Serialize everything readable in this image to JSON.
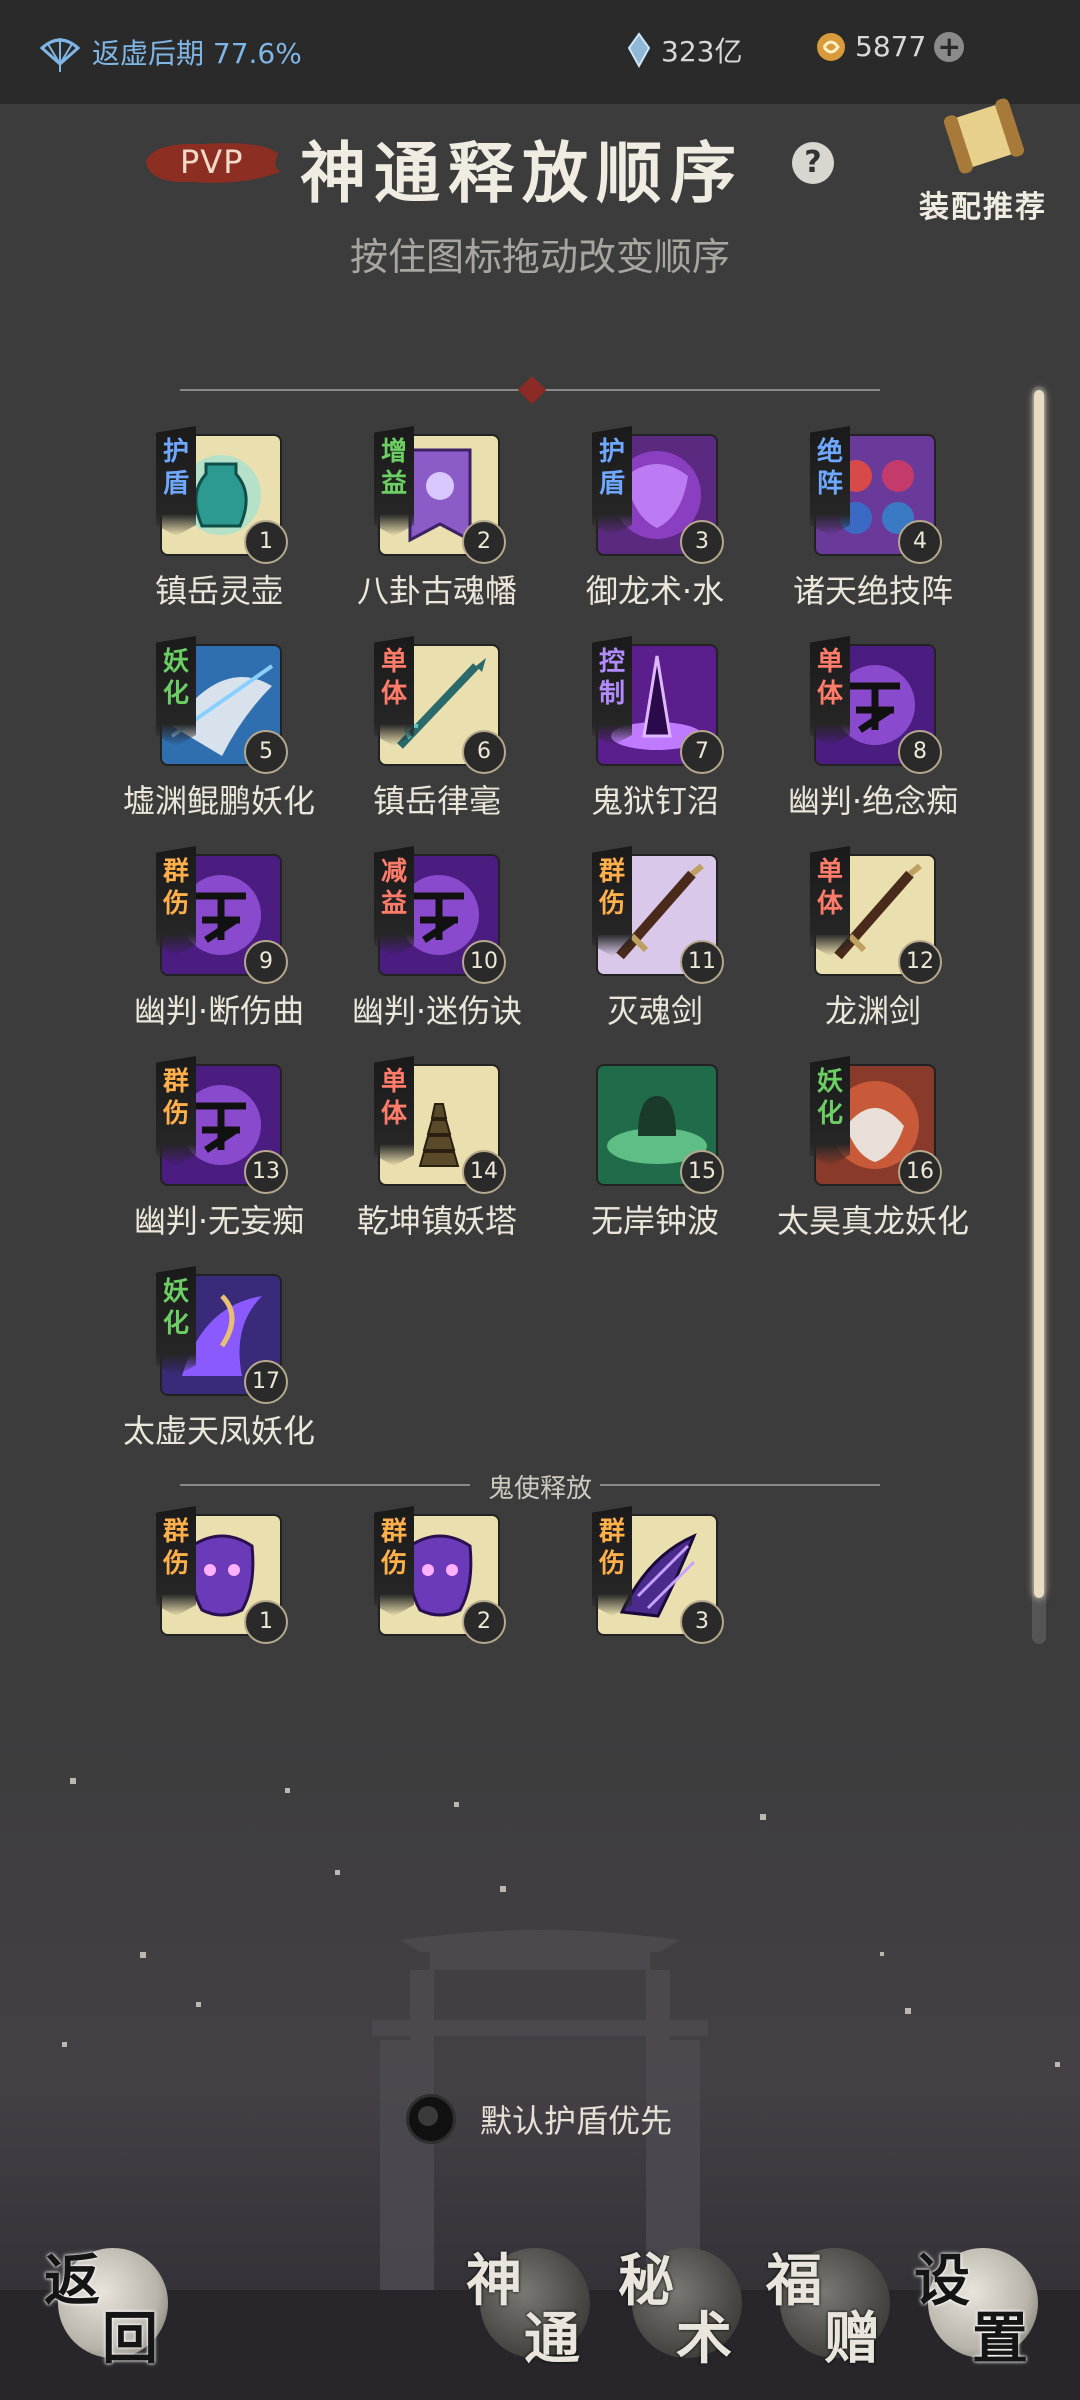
{
  "status": {
    "stage_label": "返虚后期 77.6%",
    "spirit_stones": "323亿",
    "currency": "5877"
  },
  "header": {
    "pvp_badge": "PVP",
    "title": "神通释放顺序",
    "recommend_label": "装配推荐",
    "subtitle": "按住图标拖动改变顺序"
  },
  "skills": [
    {
      "tag": "护盾",
      "tag_color": "#6fa8ff",
      "num": "1",
      "name": "镇岳灵壶",
      "bg": "#eadfae",
      "icon": "vase-icon"
    },
    {
      "tag": "增益",
      "tag_color": "#6ccf63",
      "num": "2",
      "name": "八卦古魂幡",
      "bg": "#eadfae",
      "icon": "banner-icon"
    },
    {
      "tag": "护盾",
      "tag_color": "#6fa8ff",
      "num": "3",
      "name": "御龙术·水",
      "bg": "#5b2a80",
      "icon": "dragon-mask-icon"
    },
    {
      "tag": "绝阵",
      "tag_color": "#6fa8ff",
      "num": "4",
      "name": "诸天绝技阵",
      "bg": "#6a3a9a",
      "icon": "formation-icon"
    },
    {
      "tag": "妖化",
      "tag_color": "#6ccf63",
      "num": "5",
      "name": "墟渊鲲鹏妖化",
      "bg": "#2f6fb0",
      "icon": "kunpeng-icon"
    },
    {
      "tag": "单体",
      "tag_color": "#ff7b6a",
      "num": "6",
      "name": "镇岳律毫",
      "bg": "#eadfae",
      "icon": "spear-icon"
    },
    {
      "tag": "控制",
      "tag_color": "#b28cff",
      "num": "7",
      "name": "鬼狱钉沼",
      "bg": "#5a1f8c",
      "icon": "spike-icon"
    },
    {
      "tag": "单体",
      "tag_color": "#ff7b6a",
      "num": "8",
      "name": "幽判·绝念痴",
      "bg": "#4b1d80",
      "icon": "rune-icon"
    },
    {
      "tag": "群伤",
      "tag_color": "#ffb04a",
      "num": "9",
      "name": "幽判·断伤曲",
      "bg": "#4b1d80",
      "icon": "rune-icon"
    },
    {
      "tag": "减益",
      "tag_color": "#ff7b6a",
      "num": "10",
      "name": "幽判·迷伤诀",
      "bg": "#4b1d80",
      "icon": "rune-icon"
    },
    {
      "tag": "群伤",
      "tag_color": "#ffb04a",
      "num": "11",
      "name": "灭魂剑",
      "bg": "#d9c8ea",
      "icon": "sword-icon"
    },
    {
      "tag": "单体",
      "tag_color": "#ff7b6a",
      "num": "12",
      "name": "龙渊剑",
      "bg": "#eadfae",
      "icon": "sword-icon"
    },
    {
      "tag": "群伤",
      "tag_color": "#ffb04a",
      "num": "13",
      "name": "幽判·无妄痴",
      "bg": "#4b1d80",
      "icon": "rune-icon"
    },
    {
      "tag": "单体",
      "tag_color": "#ff7b6a",
      "num": "14",
      "name": "乾坤镇妖塔",
      "bg": "#eadfae",
      "icon": "pagoda-icon"
    },
    {
      "tag": "",
      "tag_color": "#ffffff",
      "num": "15",
      "name": "无岸钟波",
      "bg": "#1f6b4a",
      "icon": "bell-icon"
    },
    {
      "tag": "妖化",
      "tag_color": "#6ccf63",
      "num": "16",
      "name": "太昊真龙妖化",
      "bg": "#8a3a2a",
      "icon": "dragon-head-icon"
    },
    {
      "tag": "妖化",
      "tag_color": "#6ccf63",
      "num": "17",
      "name": "太虚天凤妖化",
      "bg": "#3a2a7a",
      "icon": "phoenix-icon"
    }
  ],
  "ghost_section": {
    "label": "鬼使释放",
    "items": [
      {
        "tag": "群伤",
        "tag_color": "#ffb04a",
        "num": "1",
        "bg": "#eadfae",
        "icon": "ghost-mask-icon"
      },
      {
        "tag": "群伤",
        "tag_color": "#ffb04a",
        "num": "2",
        "bg": "#eadfae",
        "icon": "ghost-mask-icon"
      },
      {
        "tag": "群伤",
        "tag_color": "#ffb04a",
        "num": "3",
        "bg": "#eadfae",
        "icon": "ghost-claw-icon"
      }
    ]
  },
  "toggle": {
    "label": "默认护盾优先"
  },
  "nav": {
    "back": [
      "返",
      "回"
    ],
    "shentong": [
      "神",
      "通"
    ],
    "mishu": [
      "秘",
      "术"
    ],
    "fuzeng": [
      "福",
      "赠"
    ],
    "settings": [
      "设",
      "置"
    ]
  }
}
